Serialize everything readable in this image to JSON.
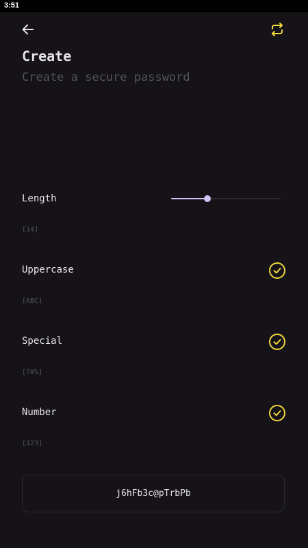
{
  "status_bar": {
    "time": "3:51"
  },
  "header": {
    "back_icon": "arrow-left-icon",
    "regenerate_icon": "refresh-icon",
    "title": "Create",
    "subtitle": "Create a secure password"
  },
  "options": {
    "length": {
      "label": "Length",
      "hint": "[14]",
      "slider_fraction": 0.33
    },
    "uppercase": {
      "label": "Uppercase",
      "hint": "[ABC]",
      "checked": true
    },
    "special": {
      "label": "Special",
      "hint": "[?#%]",
      "checked": true
    },
    "number": {
      "label": "Number",
      "hint": "[123]",
      "checked": true
    }
  },
  "password": {
    "value": "j6hFb3c@pTrbPb"
  },
  "colors": {
    "background": "#151317",
    "accent": "#f3d83c",
    "slider": "#cfc2f2",
    "muted_text": "#55525b"
  }
}
